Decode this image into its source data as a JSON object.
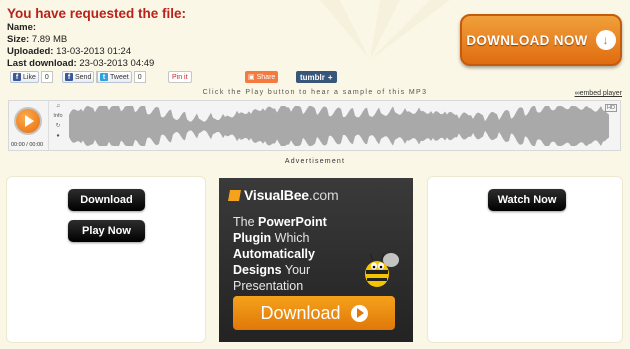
{
  "header": {
    "title": "You have requested the file:",
    "name_label": "Name:",
    "name_value": "",
    "size_label": "Size:",
    "size_value": "7.89 MB",
    "uploaded_label": "Uploaded:",
    "uploaded_value": "13-03-2013 01:24",
    "lastdl_label": "Last download:",
    "lastdl_value": "23-03-2013 04:49"
  },
  "download_main": {
    "label": "DOWNLOAD NOW",
    "icon": "arrow-down-circle-icon"
  },
  "social": {
    "like": {
      "label": "Like",
      "count": "0"
    },
    "send": {
      "label": "Send",
      "count": "0"
    },
    "tweet": {
      "label": "Tweet",
      "count": "0"
    },
    "pin": {
      "label": "Pin it"
    },
    "share": {
      "label": "Share"
    },
    "tumblr": {
      "label": "tumblr",
      "plus": "+"
    }
  },
  "player": {
    "hint": "Click the Play button to hear a sample of this MP3",
    "embed_label": "embed player",
    "time": "00:00 / 00:00",
    "info_label": "Info",
    "hd_label": "HD"
  },
  "ad": {
    "label": "Advertisement",
    "brand_main": "VisualBee",
    "brand_tld": ".com",
    "copy_1": "The ",
    "copy_2": "PowerPoint Plugin",
    "copy_3": " Which ",
    "copy_4": "Automatically",
    "copy_5": "Designs",
    "copy_6": " Your Presentation",
    "button": "Download"
  },
  "left_panel": {
    "download": "Download",
    "play": "Play Now"
  },
  "right_panel": {
    "watch": "Watch Now"
  },
  "colors": {
    "accent": "#e06c10",
    "title": "#b9211b",
    "page_bg": "#fbf7e6"
  }
}
